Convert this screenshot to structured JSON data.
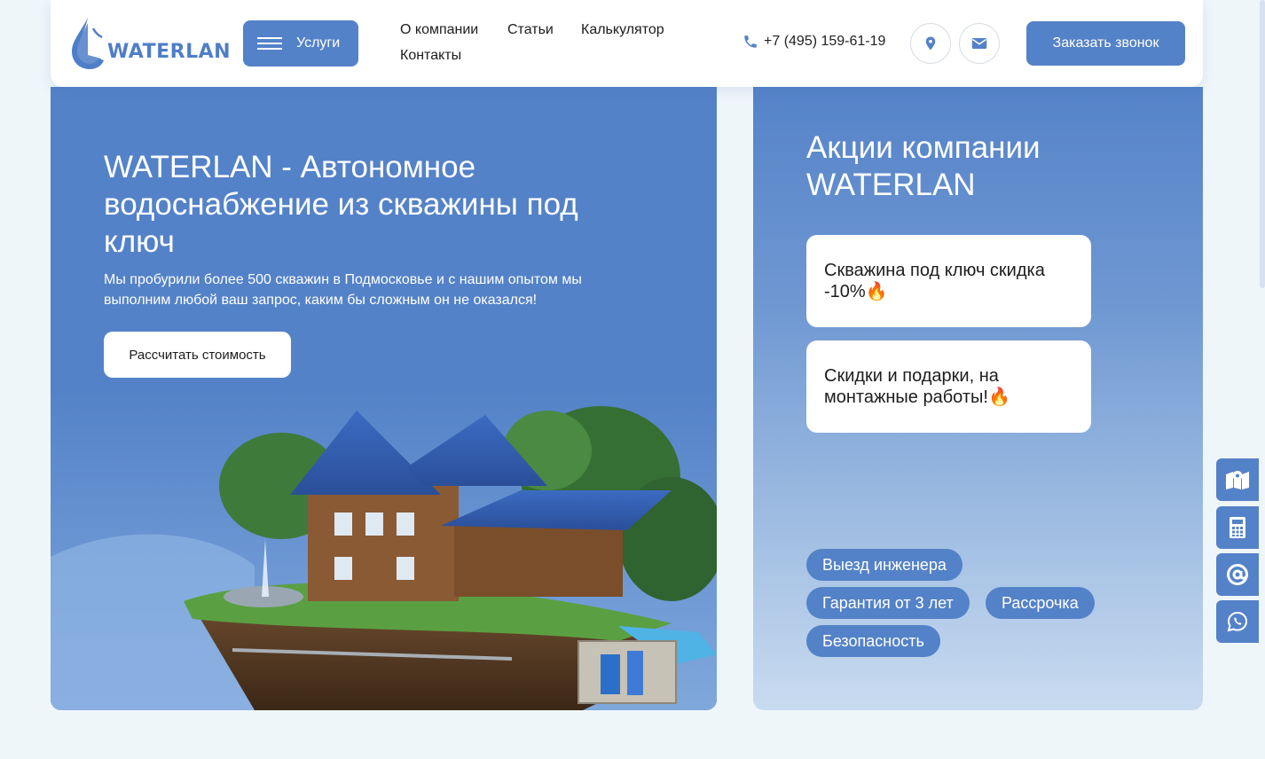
{
  "header": {
    "logo_text": "WATERLAN",
    "services_label": "Услуги",
    "nav": [
      "О компании",
      "Статьи",
      "Калькулятор",
      "Контакты"
    ],
    "phone": "+7 (495) 159-61-19",
    "callback_label": "Заказать звонок"
  },
  "hero": {
    "title": "WATERLAN - Автономное водоснабжение из скважины под ключ",
    "subtitle": "Мы пробурили более 500 скважин в Подмосковье и с нашим опытом мы выполним любой ваш запрос, каким бы сложным он не оказался!",
    "cta_label": "Рассчитать стоимость"
  },
  "promo": {
    "title": "Акции компании WATERLAN",
    "cards": [
      {
        "text": "Скважина под ключ скидка -10%",
        "emoji": "🔥"
      },
      {
        "text": "Скидки и подарки, на монтажные работы!",
        "emoji": "🔥"
      }
    ],
    "tags": [
      "Выезд инженера",
      "Гарантия от 3 лет",
      "Рассрочка",
      "Безопасность"
    ]
  },
  "side_tools": [
    "map-icon",
    "calculator-icon",
    "email-at-icon",
    "whatsapp-icon"
  ],
  "colors": {
    "accent": "#5482c8",
    "background": "#eff6fa",
    "white": "#ffffff"
  }
}
